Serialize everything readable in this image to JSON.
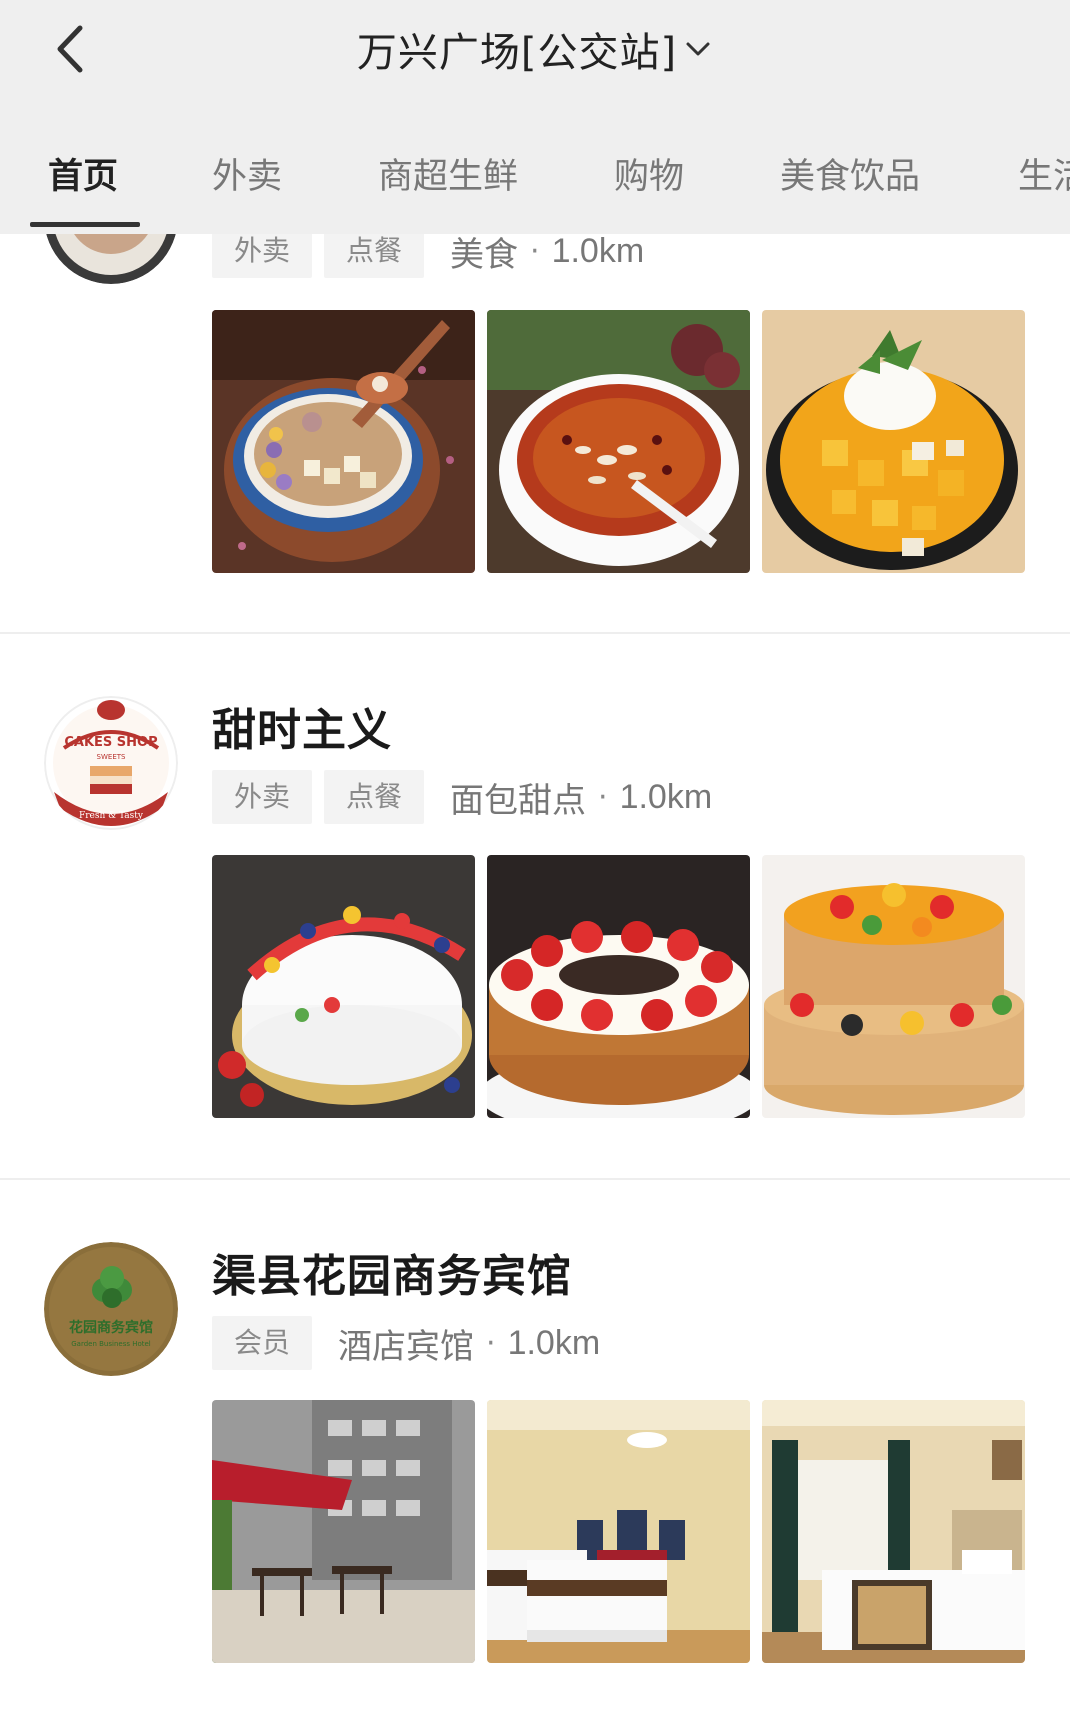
{
  "header": {
    "back_icon": "chevron-left-icon",
    "title": "万兴广场[公交站]",
    "dropdown_icon": "chevron-down-icon",
    "tabs": [
      {
        "label": "首页",
        "active": true
      },
      {
        "label": "外卖",
        "active": false
      },
      {
        "label": "商超生鲜",
        "active": false
      },
      {
        "label": "购物",
        "active": false
      },
      {
        "label": "美食饮品",
        "active": false
      },
      {
        "label": "生活",
        "active": false
      }
    ]
  },
  "shops": [
    {
      "name": "",
      "tags": [
        "外卖",
        "点餐"
      ],
      "category": "美食",
      "separator": "·",
      "distance": "1.0km",
      "photos": [
        "taro-dessert-bowl",
        "red-dessert-soup",
        "mango-shaved-ice"
      ]
    },
    {
      "name": "甜时主义",
      "logo_text": {
        "top": "CAKES SHOP",
        "middle": "SWEETS",
        "ribbon": "Fresh & Tasty"
      },
      "tags": [
        "外卖",
        "点餐"
      ],
      "category": "面包甜点",
      "separator": "·",
      "distance": "1.0km",
      "photos": [
        "fruit-cream-cake",
        "strawberry-cake",
        "two-tier-fruit-cake"
      ]
    },
    {
      "name": "渠县花园商务宾馆",
      "logo_text": {
        "main": "花园商务宾馆",
        "sub": "Garden Business Hotel"
      },
      "tags": [
        "会员"
      ],
      "category": "酒店宾馆",
      "separator": "·",
      "distance": "1.0km",
      "photos": [
        "hotel-terrace",
        "hotel-twin-room",
        "hotel-bedroom"
      ]
    }
  ],
  "colors": {
    "header_bg": "#efefef",
    "tag_bg": "#f3f3f3",
    "tag_text": "#8a8a8a",
    "active_tab": "#222222",
    "inactive_tab": "#777777"
  }
}
